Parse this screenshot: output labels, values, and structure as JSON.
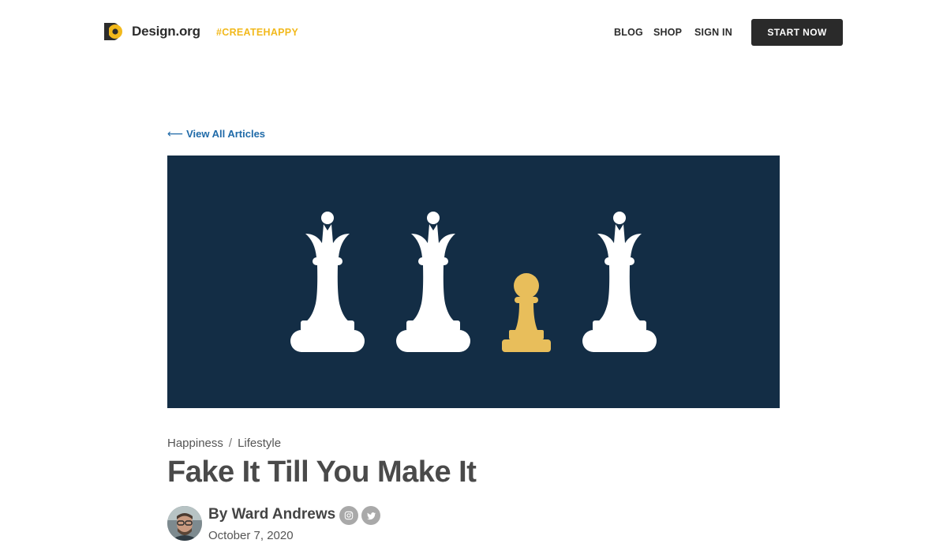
{
  "brand": {
    "name": "Design.org",
    "tagline": "#CREATEHAPPY",
    "accent_color": "#f2b91c",
    "logo_icon": "design-org-logo-icon"
  },
  "nav": {
    "items": [
      {
        "label": "BLOG"
      },
      {
        "label": "SHOP"
      },
      {
        "label": "SIGN IN"
      }
    ],
    "cta_label": "START NOW"
  },
  "back_link": {
    "label": "View All Articles",
    "icon": "arrow-left-icon"
  },
  "hero": {
    "background_color": "#132d45",
    "pieces": [
      "queen",
      "queen",
      "pawn",
      "queen"
    ],
    "piece_colors": {
      "queen": "#ffffff",
      "pawn": "#e8be5b"
    }
  },
  "article": {
    "categories": [
      "Happiness",
      "Lifestyle"
    ],
    "category_separator": "/",
    "title": "Fake It Till You Make It",
    "author": "By Ward Andrews",
    "date": "October 7, 2020",
    "social_icons": [
      "instagram-icon",
      "twitter-icon"
    ]
  }
}
